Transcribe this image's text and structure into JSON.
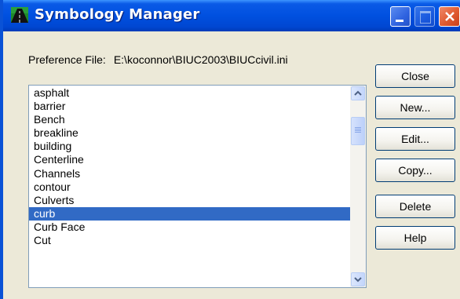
{
  "window": {
    "title": "Symbology Manager",
    "icon": "road-app-icon",
    "controls": [
      "minimize-icon",
      "maximize-icon",
      "close-icon"
    ]
  },
  "preference": {
    "label": "Preference File:",
    "path": "E:\\koconnor\\BIUC2003\\BIUCcivil.ini"
  },
  "list": {
    "items": [
      "asphalt",
      "barrier",
      "Bench",
      "breakline",
      "building",
      "Centerline",
      "Channels",
      "contour",
      "Culverts",
      "curb",
      "Curb Face",
      "Cut"
    ],
    "selected": "curb"
  },
  "buttons": {
    "close": "Close",
    "new": "New...",
    "edit": "Edit...",
    "copy": "Copy...",
    "delete": "Delete",
    "help": "Help"
  },
  "colors": {
    "titlebar": "#0050e0",
    "selection": "#316ac5",
    "dialog": "#ece9d8"
  }
}
